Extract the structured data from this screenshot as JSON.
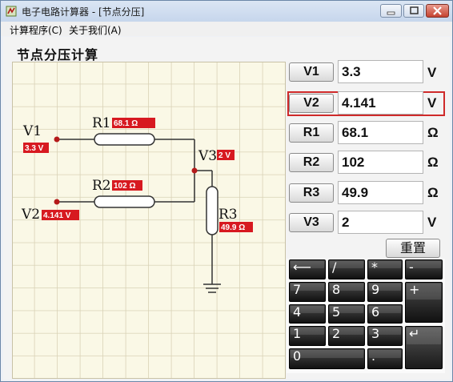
{
  "window": {
    "title": "电子电路计算器 - [节点分压]"
  },
  "menu": [
    "计算程序(C)",
    "关于我们(A)"
  ],
  "heading": "节点分压计算",
  "diagram": {
    "v1_label": "V1",
    "v1_value": "3.3 V",
    "v2_label": "V2",
    "v2_value": "4.141 V",
    "v3_label": "V3",
    "v3_value": "2 V",
    "r1_label": "R1",
    "r1_value": "68.1 Ω",
    "r2_label": "R2",
    "r2_value": "102 Ω",
    "r3_label": "R3",
    "r3_value": "49.9 Ω"
  },
  "fields": [
    {
      "button": "V1",
      "value": "3.3",
      "unit": "V"
    },
    {
      "button": "V2",
      "value": "4.141",
      "unit": "V"
    },
    {
      "button": "R1",
      "value": "68.1",
      "unit": "Ω"
    },
    {
      "button": "R2",
      "value": "102",
      "unit": "Ω"
    },
    {
      "button": "R3",
      "value": "49.9",
      "unit": "Ω"
    },
    {
      "button": "V3",
      "value": "2",
      "unit": "V"
    }
  ],
  "reset_label": "重置",
  "keypad": {
    "backspace": "⟵",
    "divide": "/",
    "multiply": "*",
    "minus": "-",
    "plus": "+",
    "seven": "7",
    "eight": "8",
    "nine": "9",
    "four": "4",
    "five": "5",
    "six": "6",
    "one": "1",
    "two": "2",
    "three": "3",
    "zero": "0",
    "dot": ".",
    "enter": "↵"
  },
  "colors": {
    "accent_red": "#d71920",
    "selection_border": "#cf2a2a",
    "grid_line": "#d9d2b6",
    "grid_bg": "#faf8e6"
  }
}
